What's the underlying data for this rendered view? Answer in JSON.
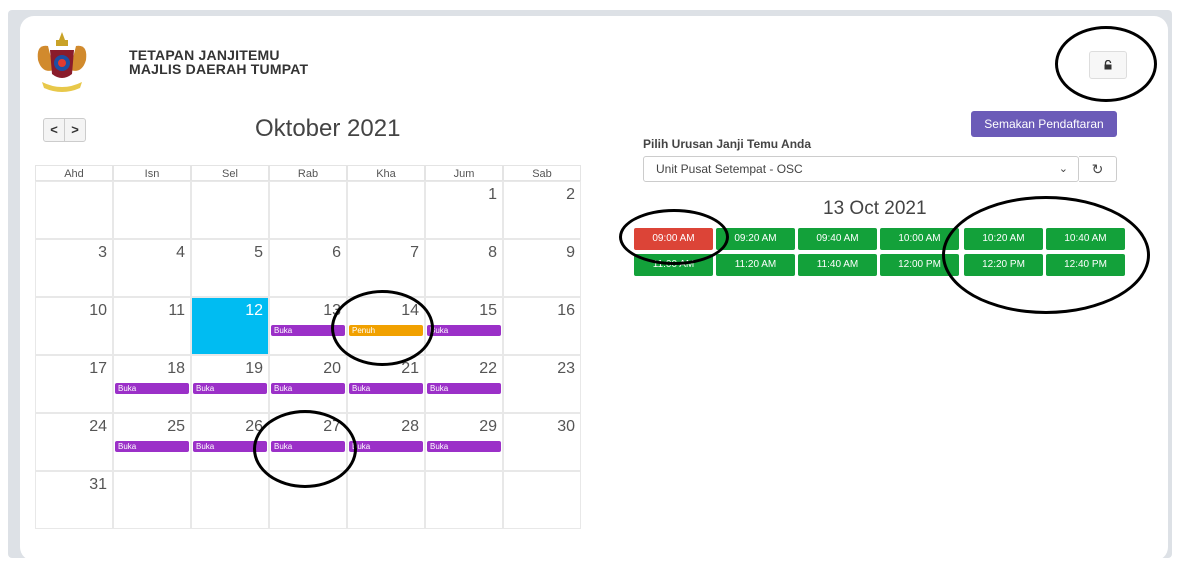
{
  "header": {
    "line1": "TETAPAN JANJITEMU",
    "line2": "MAJLIS DAERAH TUMPAT"
  },
  "icons": {
    "logo": "crest-logo",
    "lock": "lock-icon",
    "prev": "chevron-left-icon",
    "next": "chevron-right-icon",
    "refresh": "refresh-icon",
    "dropdown": "chevron-down-icon"
  },
  "calendar": {
    "month_title": "Oktober 2021",
    "weekdays": [
      "Ahd",
      "Isn",
      "Sel",
      "Rab",
      "Kha",
      "Jum",
      "Sab"
    ],
    "prev_label": "<",
    "next_label": ">",
    "days": [
      "1",
      "2",
      "3",
      "4",
      "5",
      "6",
      "7",
      "8",
      "9",
      "10",
      "11",
      "12",
      "13",
      "14",
      "15",
      "16",
      "17",
      "18",
      "19",
      "20",
      "21",
      "22",
      "23",
      "24",
      "25",
      "26",
      "27",
      "28",
      "29",
      "30",
      "31"
    ],
    "event_buka": "Buka",
    "event_penuh": "Penuh"
  },
  "booking": {
    "check_button": "Semakan Pendaftaran",
    "select_label": "Pilih Urusan Janji Temu Anda",
    "selected_service": "Unit Pusat Setempat - OSC",
    "date_title": "13 Oct 2021",
    "slots": [
      "09:00 AM",
      "09:20 AM",
      "09:40 AM",
      "10:00 AM",
      "10:20 AM",
      "10:40 AM",
      "11:00 AM",
      "11:20 AM",
      "11:40 AM",
      "12:00 PM",
      "12:20 PM",
      "12:40 PM"
    ]
  },
  "colors": {
    "today": "#00bcf2",
    "buka": "#9b30c8",
    "penuh": "#f1a100",
    "slot_available": "#13a13a",
    "slot_full": "#dc4437",
    "button": "#6b5bb8"
  }
}
